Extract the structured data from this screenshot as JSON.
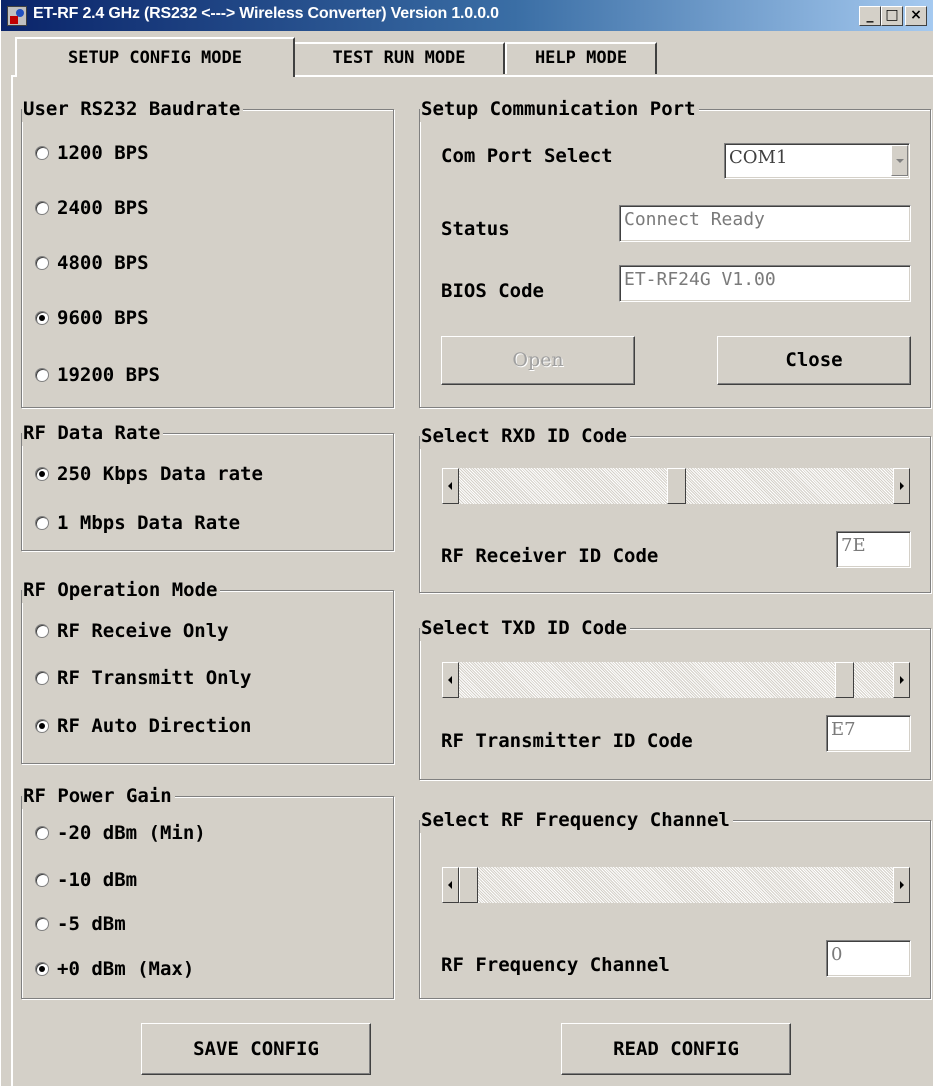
{
  "window": {
    "title": "ET-RF 2.4 GHz (RS232 <---> Wireless Converter) Version 1.0.0.0",
    "title_bar_buttons": {
      "minimize": "_",
      "maximize": "□",
      "close": "×"
    }
  },
  "tabs": [
    {
      "label": "SETUP CONFIG MODE",
      "active": true
    },
    {
      "label": "TEST RUN MODE",
      "active": false
    },
    {
      "label": "HELP MODE",
      "active": false
    }
  ],
  "baudrate": {
    "title": "User RS232 Baudrate",
    "options": [
      {
        "label": "1200 BPS",
        "selected": false
      },
      {
        "label": "2400 BPS",
        "selected": false
      },
      {
        "label": "4800 BPS",
        "selected": false
      },
      {
        "label": "9600 BPS",
        "selected": true
      },
      {
        "label": "19200 BPS",
        "selected": false
      }
    ]
  },
  "rf_data_rate": {
    "title": "RF Data Rate",
    "options": [
      {
        "label": "250 Kbps Data rate",
        "selected": true
      },
      {
        "label": "1 Mbps Data Rate",
        "selected": false
      }
    ]
  },
  "rf_operation_mode": {
    "title": "RF Operation Mode",
    "options": [
      {
        "label": "RF Receive Only",
        "selected": false
      },
      {
        "label": "RF Transmitt Only",
        "selected": false
      },
      {
        "label": "RF Auto Direction",
        "selected": true
      }
    ]
  },
  "rf_power_gain": {
    "title": "RF Power Gain",
    "options": [
      {
        "label": "-20 dBm (Min)",
        "selected": false
      },
      {
        "label": "-10 dBm",
        "selected": false
      },
      {
        "label": "-5 dBm",
        "selected": false
      },
      {
        "label": "+0 dBm (Max)",
        "selected": true
      }
    ]
  },
  "com_port": {
    "title": "Setup Communication Port",
    "select_label": "Com Port Select",
    "select_value": "COM1",
    "status_label": "Status",
    "status_value": "Connect Ready",
    "bios_label": "BIOS Code",
    "bios_value": "ET-RF24G V1.00",
    "open_label": "Open",
    "close_label": "Close"
  },
  "rxd": {
    "title": "Select RXD ID Code",
    "code_label": "RF Receiver ID Code",
    "code_value": "7E",
    "slider_fraction": 0.5
  },
  "txd": {
    "title": "Select TXD ID Code",
    "code_label": "RF Transmitter ID Code",
    "code_value": "E7",
    "slider_fraction": 0.906
  },
  "channel": {
    "title": "Select RF Frequency Channel",
    "code_label": "RF Frequency Channel",
    "code_value": "0",
    "slider_fraction": 0
  },
  "actions": {
    "save_label": "SAVE CONFIG",
    "read_label": "READ CONFIG"
  }
}
